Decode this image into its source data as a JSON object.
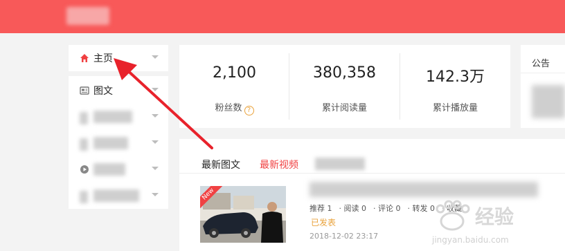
{
  "sidebar": {
    "home_label": "主页",
    "items": [
      {
        "label": "图文"
      },
      {
        "label": ""
      },
      {
        "label": ""
      },
      {
        "label": ""
      },
      {
        "label": ""
      }
    ]
  },
  "stats": [
    {
      "value": "2,100",
      "label": "粉丝数"
    },
    {
      "value": "380,358",
      "label": "累计阅读量"
    },
    {
      "value": "142.3万",
      "label": "累计播放量"
    }
  ],
  "notice": {
    "title": "公告"
  },
  "tabs": {
    "latest_articles": "最新图文",
    "latest_videos": "最新视频"
  },
  "article": {
    "badge": "New",
    "meta": {
      "recommend": "推荐 1",
      "read": "阅读 0",
      "comment": "评论 0",
      "forward": "转发 0",
      "favorite": "收藏"
    },
    "status": "已发表",
    "date": "2018-12-02 23:17"
  },
  "watermark": {
    "brand": "经验",
    "url": "jingyan.baidu.com"
  },
  "colors": {
    "topbar": "#f85959",
    "accent_red": "#f04142",
    "status_orange": "#e9a23b"
  }
}
